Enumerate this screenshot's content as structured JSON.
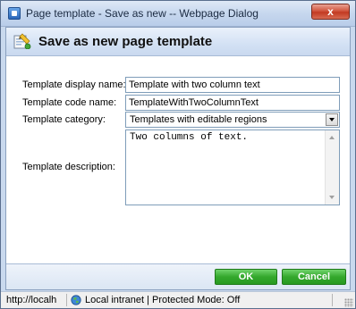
{
  "window": {
    "title": "Page template - Save as new -- Webpage Dialog",
    "close_label": "x"
  },
  "header": {
    "title": "Save as new page template",
    "icon": "page-template-save-icon"
  },
  "form": {
    "display_name": {
      "label": "Template display name:",
      "value": "Template with two column text"
    },
    "code_name": {
      "label": "Template code name:",
      "value": "TemplateWithTwoColumnText"
    },
    "category": {
      "label": "Template category:",
      "selected": "Templates with editable regions"
    },
    "description": {
      "label": "Template description:",
      "value": "Two columns of text."
    }
  },
  "buttons": {
    "ok_label": "OK",
    "cancel_label": "Cancel"
  },
  "statusbar": {
    "url": "http://localh",
    "zone": "Local intranet | Protected Mode: Off"
  },
  "colors": {
    "accent_green": "#34a82d",
    "header_bg": "#d3e1f4",
    "close_red": "#c23a22"
  }
}
